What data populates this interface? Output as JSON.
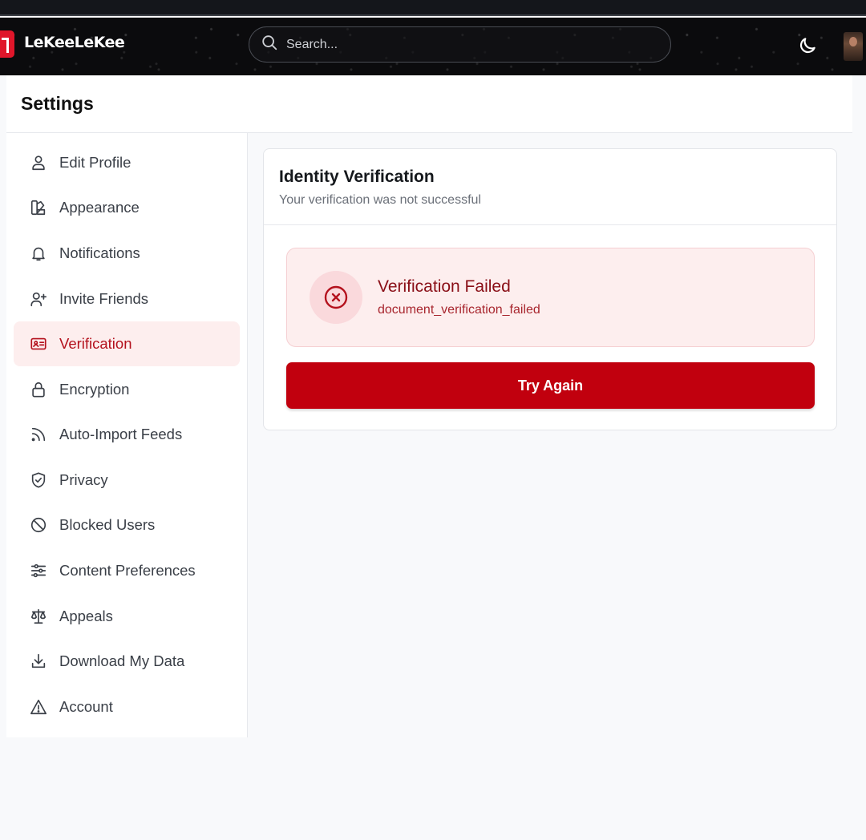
{
  "colors": {
    "accent": "#c1000e",
    "brand": "#e0162a",
    "active_bg": "#fdeeee",
    "alert_title": "#8a0f17"
  },
  "header": {
    "logo_text": "LeKeeLeKee",
    "search": {
      "placeholder": "Search..."
    },
    "theme_toggle_icon": "moon-icon",
    "avatar_icon": "user-avatar"
  },
  "settings": {
    "title": "Settings"
  },
  "sidebar": {
    "items": [
      {
        "label": "Edit Profile",
        "icon": "user-icon",
        "active": false
      },
      {
        "label": "Appearance",
        "icon": "palette-icon",
        "active": false
      },
      {
        "label": "Notifications",
        "icon": "bell-icon",
        "active": false
      },
      {
        "label": "Invite Friends",
        "icon": "user-plus-icon",
        "active": false
      },
      {
        "label": "Verification",
        "icon": "id-card-icon",
        "active": true
      },
      {
        "label": "Encryption",
        "icon": "lock-icon",
        "active": false
      },
      {
        "label": "Auto-Import Feeds",
        "icon": "rss-icon",
        "active": false
      },
      {
        "label": "Privacy",
        "icon": "shield-check-icon",
        "active": false
      },
      {
        "label": "Blocked Users",
        "icon": "ban-icon",
        "active": false
      },
      {
        "label": "Content Preferences",
        "icon": "sliders-icon",
        "active": false
      },
      {
        "label": "Appeals",
        "icon": "scale-icon",
        "active": false
      },
      {
        "label": "Download My Data",
        "icon": "download-icon",
        "active": false
      },
      {
        "label": "Account",
        "icon": "warning-triangle-icon",
        "active": false
      }
    ]
  },
  "main": {
    "card": {
      "title": "Identity Verification",
      "subtitle": "Your verification was not successful",
      "alert": {
        "icon": "x-circle-icon",
        "title": "Verification Failed",
        "code": "document_verification_failed"
      },
      "action_label": "Try Again"
    }
  }
}
